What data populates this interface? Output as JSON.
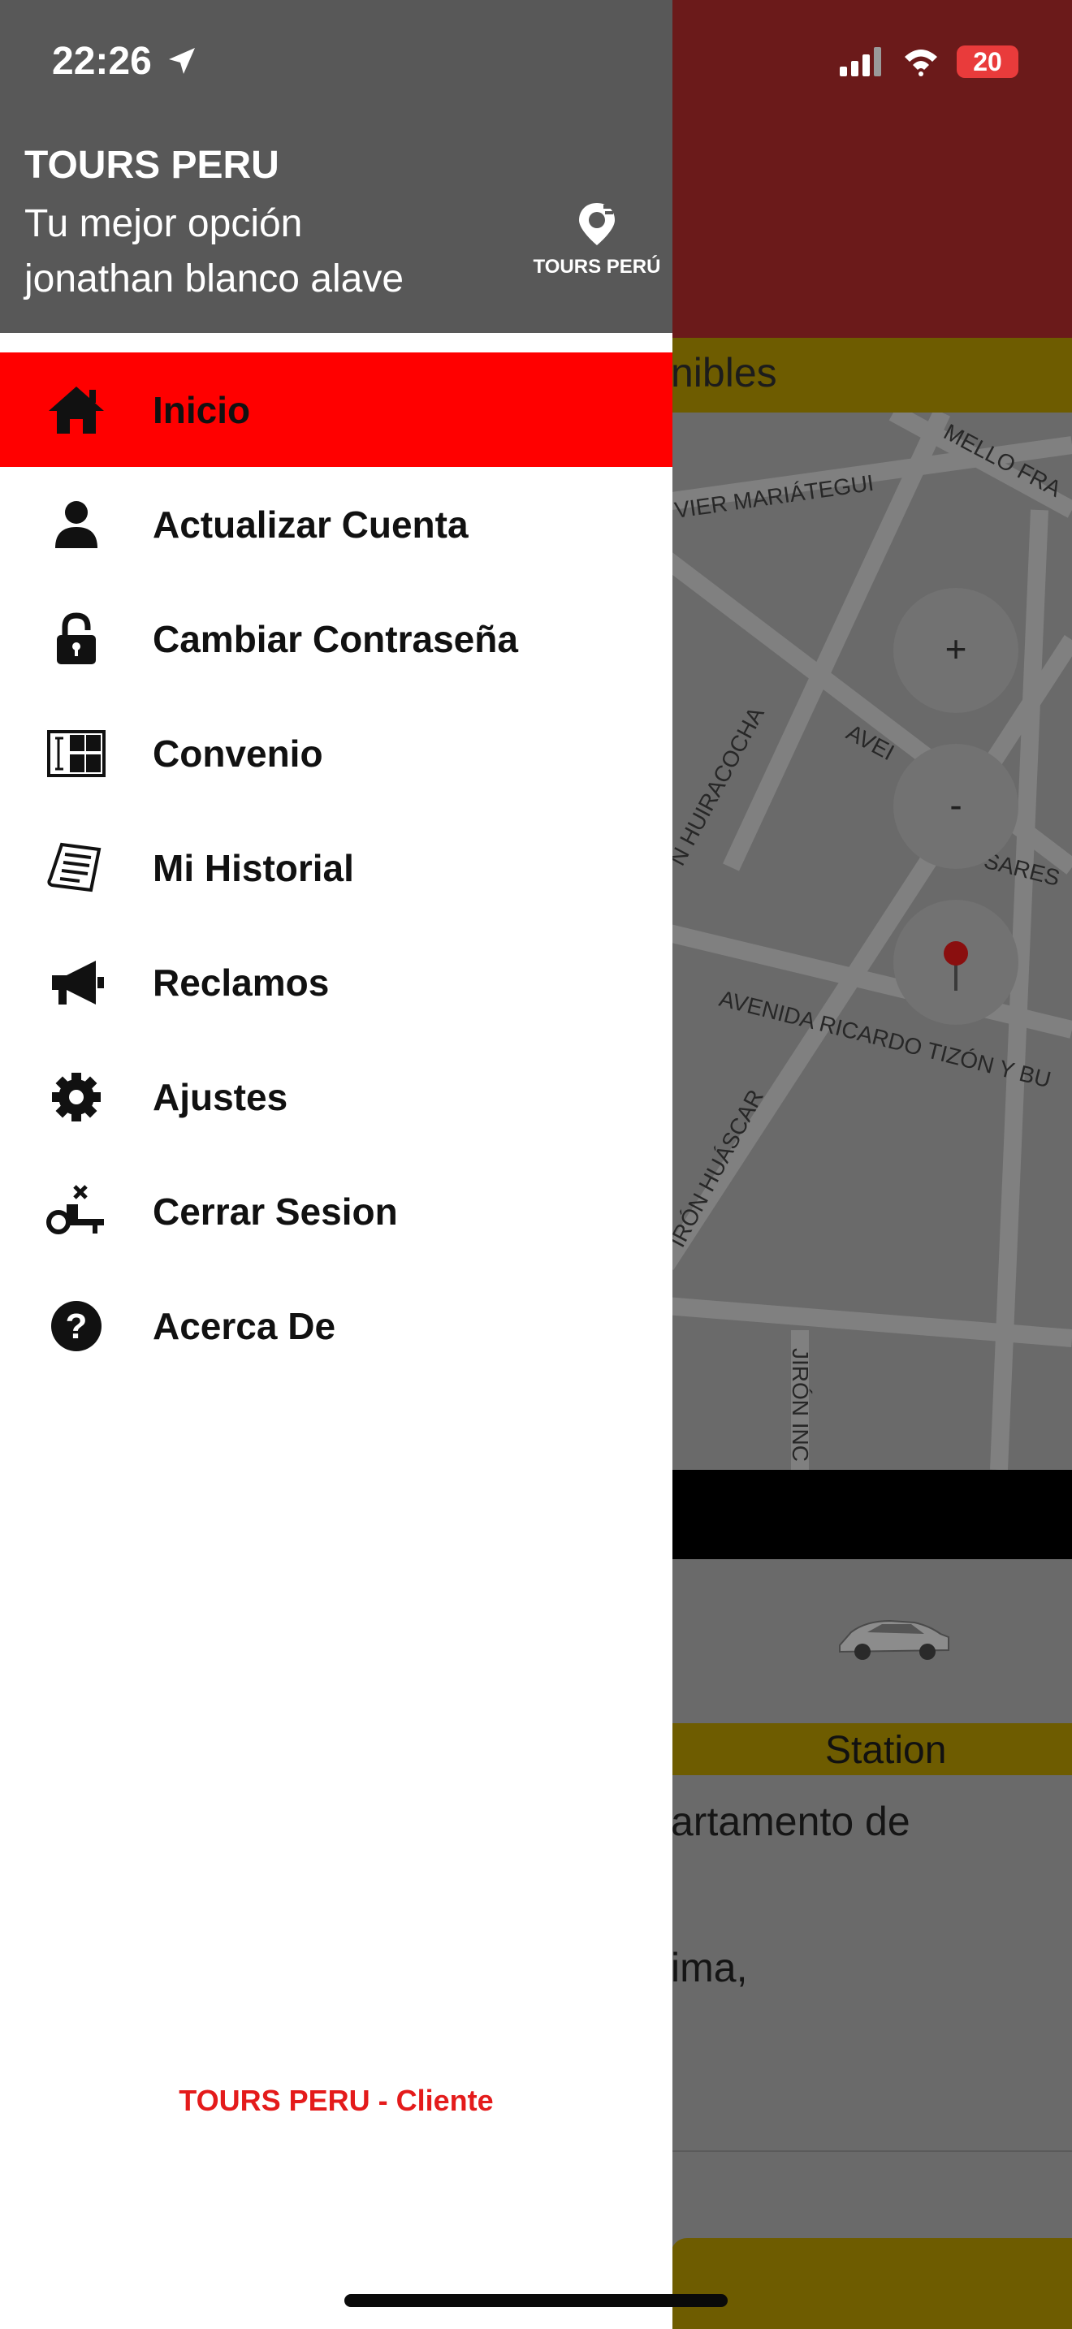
{
  "status_bar": {
    "time": "22:26",
    "battery": "20"
  },
  "drawer": {
    "title": "TOURS PERU",
    "subtitle": "Tu mejor opción",
    "user_name": "jonathan blanco alave",
    "logo_text": "TOURS PERÚ",
    "footer": "TOURS PERU - Cliente",
    "menu": [
      {
        "label": "Inicio",
        "icon": "home-icon",
        "active": true
      },
      {
        "label": "Actualizar Cuenta",
        "icon": "user-icon",
        "active": false
      },
      {
        "label": "Cambiar Contraseña",
        "icon": "lock-icon",
        "active": false
      },
      {
        "label": "Convenio",
        "icon": "agreement-icon",
        "active": false
      },
      {
        "label": "Mi Historial",
        "icon": "history-icon",
        "active": false
      },
      {
        "label": "Reclamos",
        "icon": "megaphone-icon",
        "active": false
      },
      {
        "label": "Ajustes",
        "icon": "gear-icon",
        "active": false
      },
      {
        "label": "Cerrar Sesion",
        "icon": "logout-key-icon",
        "active": false
      },
      {
        "label": "Acerca De",
        "icon": "help-icon",
        "active": false
      }
    ]
  },
  "background": {
    "available_partial": "nibles",
    "map_labels": {
      "street1": "VIER MARIÁTEGUI",
      "street2": "MELLO FRA",
      "street3": "AVEI",
      "street4": "N HUIRACOCHA",
      "street5": "SARES",
      "street6": "AVENIDA RICARDO TIZÓN Y BU",
      "street7": "IRÓN HUÁSCAR",
      "street8": "JIRÓN INC"
    },
    "zoom_in": "+",
    "zoom_out": "-",
    "station_label": "Station",
    "address_line1": "artamento de",
    "address_line2": "ima,"
  },
  "colors": {
    "drawer_header": "#585858",
    "active_item": "#ff0000",
    "footer_text": "#e41b1b",
    "bg_header": "#6b1a1a",
    "bg_strip": "#6e5c00"
  }
}
